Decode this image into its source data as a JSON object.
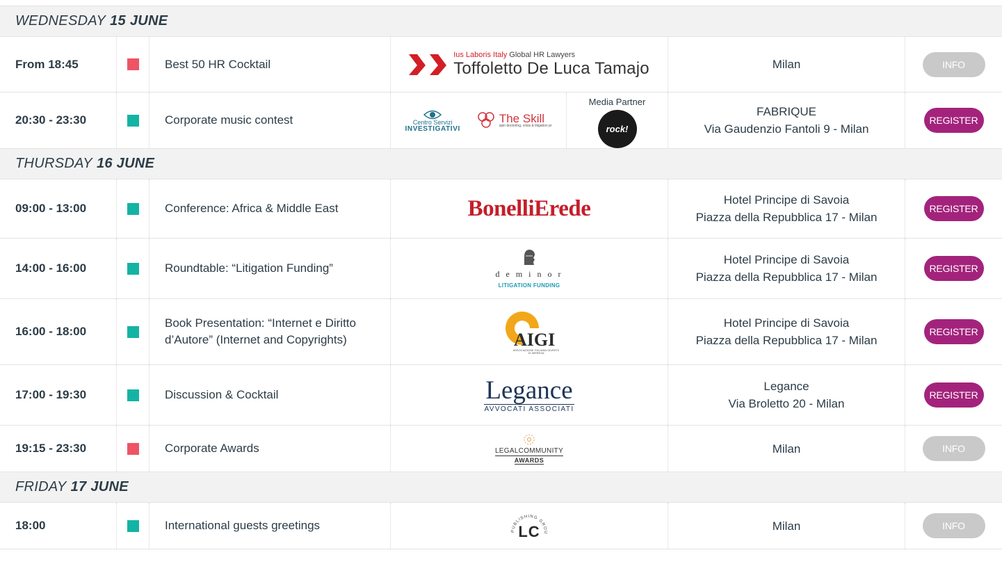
{
  "colors": {
    "social": "#ed5565",
    "conference": "#14b3a3",
    "register": "#a3237c",
    "info": "#c9c9c9"
  },
  "days": [
    {
      "label": "WEDNESDAY",
      "date": "15 JUNE",
      "events": [
        {
          "time": "From 18:45",
          "color": "social",
          "title": "Best 50 HR Cocktail",
          "logo": {
            "name": "toffoletto-logo",
            "line1a": "Ius Laboris Italy",
            "line1b": "Global HR Lawyers",
            "line2": "Toffoletto De Luca Tamajo"
          },
          "location": [
            "Milan"
          ],
          "button": "INFO"
        },
        {
          "time": "20:30 - 23:30",
          "color": "conference",
          "title": "Corporate music contest",
          "logo": {
            "name": "music-contest-logos",
            "csi_top": "Centro Servizi",
            "csi_bottom": "INVESTIGATIVI",
            "skill": "The Skill",
            "skill_sub": "spin doctoring, crisis & litigation pr",
            "media_partner": "Media Partner",
            "rock": "rock!"
          },
          "location": [
            "FABRIQUE",
            "Via Gaudenzio Fantoli 9 - Milan"
          ],
          "button": "REGISTER"
        }
      ]
    },
    {
      "label": "THURSDAY",
      "date": "16 JUNE",
      "events": [
        {
          "time": "09:00 - 13:00",
          "color": "conference",
          "title": "Conference: Africa & Middle East",
          "logo": {
            "name": "bonellierede-logo",
            "text": "BonelliErede"
          },
          "location": [
            "Hotel Principe di Savoia",
            "Piazza della Repubblica 17 - Milan"
          ],
          "button": "REGISTER"
        },
        {
          "time": "14:00 - 16:00",
          "color": "conference",
          "title": "Roundtable: “Litigation Funding”",
          "logo": {
            "name": "deminor-logo",
            "text": "d e m i n o r",
            "sub": "LITIGATION FUNDING"
          },
          "location": [
            "Hotel Principe di Savoia",
            "Piazza della Repubblica 17 - Milan"
          ],
          "button": "REGISTER"
        },
        {
          "time": "16:00 - 18:00",
          "color": "conference",
          "title": "Book Presentation: “Internet e Diritto d’Autore” (Internet and Copyrights)",
          "logo": {
            "name": "aigi-logo",
            "text": "AIGI",
            "sub": "ASSOCIAZIONE ITALIANA GIURISTI DI IMPRESA"
          },
          "location": [
            "Hotel Principe di Savoia",
            "Piazza della Repubblica 17 - Milan"
          ],
          "button": "REGISTER"
        },
        {
          "time": "17:00 - 19:30",
          "color": "conference",
          "title": "Discussion & Cocktail",
          "logo": {
            "name": "legance-logo",
            "text": "Legance",
            "sub": "AVVOCATI ASSOCIATI"
          },
          "location": [
            "Legance",
            "Via Broletto 20 - Milan"
          ],
          "button": "REGISTER"
        },
        {
          "time": "19:15 - 23:30",
          "color": "social",
          "title": "Corporate Awards",
          "logo": {
            "name": "legalcommunity-awards-logo",
            "text": "LEGALCOMMUNITY",
            "sub": "AWARDS"
          },
          "location": [
            "Milan"
          ],
          "button": "INFO"
        }
      ]
    },
    {
      "label": "FRIDAY",
      "date": "17 JUNE",
      "events": [
        {
          "time": "18:00",
          "color": "conference",
          "title": "International guests greetings",
          "logo": {
            "name": "lc-publishing-logo",
            "text": "LC",
            "arc": "PUBLISHING GROUP"
          },
          "location": [
            "Milan"
          ],
          "button": "INFO"
        }
      ]
    }
  ]
}
